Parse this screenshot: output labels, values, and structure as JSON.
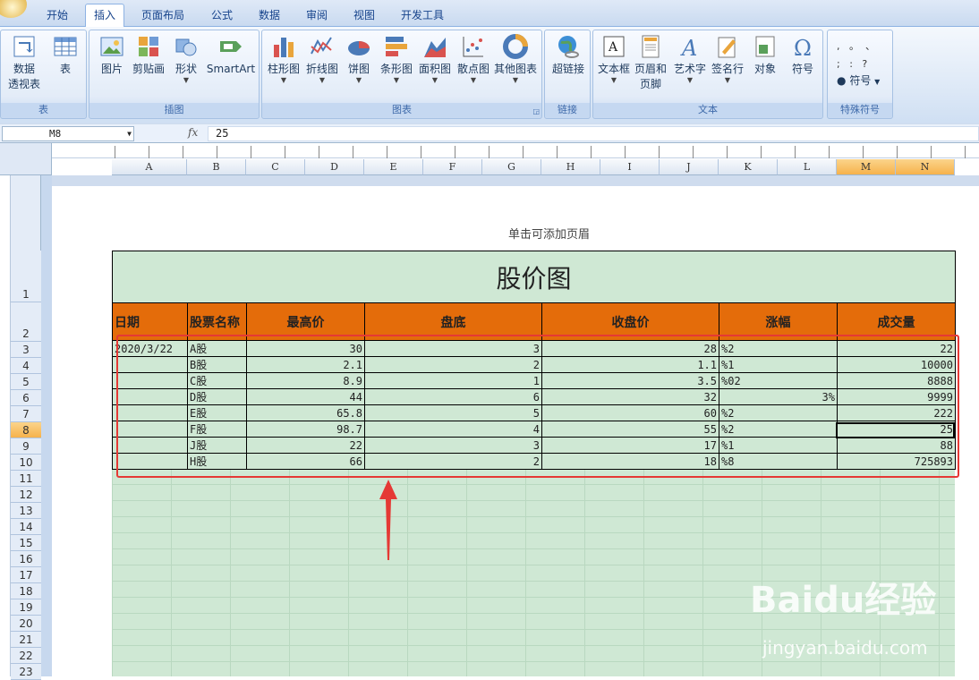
{
  "ribbon_tabs": [
    "开始",
    "插入",
    "页面布局",
    "公式",
    "数据",
    "审阅",
    "视图",
    "开发工具"
  ],
  "active_tab": "插入",
  "groups": {
    "table": {
      "label": "表",
      "buttons": [
        {
          "label": "数据\n透视表",
          "name": "pivot"
        },
        {
          "label": "表",
          "name": "table"
        }
      ]
    },
    "illustrations": {
      "label": "插图",
      "buttons": [
        {
          "label": "图片"
        },
        {
          "label": "剪贴画"
        },
        {
          "label": "形状"
        },
        {
          "label": "SmartArt"
        }
      ]
    },
    "charts": {
      "label": "图表",
      "buttons": [
        {
          "label": "柱形图"
        },
        {
          "label": "折线图"
        },
        {
          "label": "饼图"
        },
        {
          "label": "条形图"
        },
        {
          "label": "面积图"
        },
        {
          "label": "散点图"
        },
        {
          "label": "其他图表"
        }
      ]
    },
    "links": {
      "label": "链接",
      "buttons": [
        {
          "label": "超链接"
        }
      ]
    },
    "text": {
      "label": "文本",
      "buttons": [
        {
          "label": "文本框"
        },
        {
          "label": "页眉和\n页脚"
        },
        {
          "label": "艺术字"
        },
        {
          "label": "签名行"
        },
        {
          "label": "对象"
        },
        {
          "label": "符号"
        }
      ]
    },
    "special": {
      "label": "特殊符号",
      "buttons": [
        {
          "label": "符号"
        }
      ]
    }
  },
  "formula_bar": {
    "name_box": "M8",
    "fx": "fx",
    "value": "25"
  },
  "columns": [
    "A",
    "B",
    "C",
    "D",
    "E",
    "F",
    "G",
    "H",
    "I",
    "J",
    "K",
    "L",
    "M",
    "N"
  ],
  "rows": [
    "1",
    "2",
    "3",
    "4",
    "5",
    "6",
    "7",
    "8",
    "9",
    "10",
    "11",
    "12",
    "13",
    "14",
    "15",
    "16",
    "17",
    "18",
    "19",
    "20",
    "21",
    "22",
    "23"
  ],
  "header_hint": "单击可添加页眉",
  "sheet": {
    "title": "股价图",
    "headers": [
      "日期",
      "股票名称",
      "最高价",
      "盘底",
      "收盘价",
      "涨幅",
      "成交量"
    ],
    "rows": [
      {
        "date": "2020/3/22",
        "name": "A股",
        "high": "30",
        "low": "3",
        "close": "28",
        "change": "%2",
        "change2": "",
        "volume": "22"
      },
      {
        "date": "",
        "name": "B股",
        "high": "2.1",
        "low": "2",
        "close": "1.1",
        "change": "%1",
        "change2": "",
        "volume": "10000"
      },
      {
        "date": "",
        "name": "C股",
        "high": "8.9",
        "low": "1",
        "close": "3.5",
        "change": "%02",
        "change2": "",
        "volume": "8888"
      },
      {
        "date": "",
        "name": "D股",
        "high": "44",
        "low": "6",
        "close": "32",
        "change": "",
        "change2": "3%",
        "volume": "9999"
      },
      {
        "date": "",
        "name": "E股",
        "high": "65.8",
        "low": "5",
        "close": "60",
        "change": "%2",
        "change2": "",
        "volume": "222"
      },
      {
        "date": "",
        "name": "F股",
        "high": "98.7",
        "low": "4",
        "close": "55",
        "change": "%2",
        "change2": "",
        "volume": "25"
      },
      {
        "date": "",
        "name": "J股",
        "high": "22",
        "low": "3",
        "close": "17",
        "change": "%1",
        "change2": "",
        "volume": "88"
      },
      {
        "date": "",
        "name": "H股",
        "high": "66",
        "low": "2",
        "close": "18",
        "change": "%8",
        "change2": "",
        "volume": "725893"
      }
    ]
  },
  "watermark": {
    "logo": "Baidu经验",
    "url": "jingyan.baidu.com"
  },
  "colors": {
    "header_fill": "#e46c0a",
    "sheet_fill": "#cfe8d4",
    "highlight_box": "#e53935"
  }
}
